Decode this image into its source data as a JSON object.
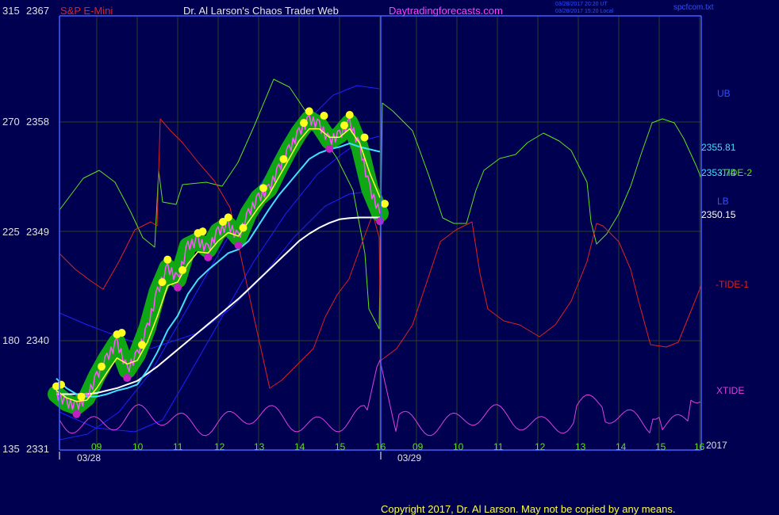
{
  "header": {
    "instrument": "S&P E-Mini",
    "title": "Dr. Al Larson's Chaos Trader Web",
    "site": "Daytradingforecasts.com",
    "stamp_line1": "03/28/2017 20:20 UT",
    "stamp_line2": "03/28/2017 15:20 Local",
    "file": "spcfcom.txt"
  },
  "footer": {
    "copyright": "Copyright 2017, Dr. Al Larson. May not be copied by any means."
  },
  "colors": {
    "background": "#000050",
    "grid": "#2e3f20",
    "frame": "#4060ff",
    "price": "#ff55ff",
    "fast_avg": "#ffff40",
    "mid_avg": "#40e0ff",
    "slow_avg": "#ffffff",
    "bands": "#2020ff",
    "tide1": "#e02020",
    "tide2": "#60e020",
    "xtide": "#e040e0",
    "highlight": "#10b010",
    "peak_dot": "#ffff20",
    "trough_dot": "#c020c0"
  },
  "chart_data": {
    "type": "line",
    "title": "S&P E-Mini",
    "x_time_labels": [
      "09",
      "10",
      "11",
      "12",
      "13",
      "14",
      "15",
      "16",
      "09",
      "10",
      "11",
      "12",
      "13",
      "14",
      "15",
      "16"
    ],
    "date_labels": [
      "03/28",
      "03/29"
    ],
    "year_label": "2017",
    "y_left_outer": [
      "315",
      "270",
      "225",
      "180",
      "135"
    ],
    "y_left_price": [
      "2367",
      "2358",
      "2349",
      "2340",
      "2331"
    ],
    "ylim": [
      2331,
      2367
    ],
    "right_labels": {
      "ub": "UB",
      "cyan_value": "2355.81",
      "upper_value": "2353.74",
      "tide2": "-TIDE-2",
      "lb": "LB",
      "white_value": "2350.15",
      "tide1": "-TIDE-1",
      "xtide": "XTIDE"
    },
    "x": [
      8.0,
      8.25,
      8.5,
      8.75,
      9.0,
      9.25,
      9.5,
      9.75,
      10.0,
      10.25,
      10.5,
      10.75,
      11.0,
      11.25,
      11.5,
      11.75,
      12.0,
      12.25,
      12.5,
      12.75,
      13.0,
      13.25,
      13.5,
      13.75,
      14.0,
      14.25,
      14.5,
      14.75,
      15.0,
      15.25,
      15.5,
      15.75,
      16.0
    ],
    "series": [
      {
        "name": "price",
        "values": [
          2335.5,
          2334.8,
          2334.5,
          2335.2,
          2337.0,
          2338.5,
          2339.8,
          2337.5,
          2338.8,
          2341.0,
          2344.0,
          2346.0,
          2345.0,
          2347.8,
          2348.2,
          2347.5,
          2349.0,
          2349.5,
          2348.5,
          2350.5,
          2351.8,
          2352.5,
          2354.2,
          2355.8,
          2357.2,
          2358.3,
          2357.8,
          2356.5,
          2357.0,
          2358.0,
          2356.0,
          2352.5,
          2350.5
        ]
      },
      {
        "name": "fast average",
        "values": [
          2335.8,
          2335.2,
          2334.9,
          2335.0,
          2336.0,
          2337.3,
          2338.5,
          2338.0,
          2338.3,
          2339.8,
          2342.0,
          2344.5,
          2344.8,
          2346.3,
          2347.3,
          2347.2,
          2348.2,
          2348.9,
          2348.6,
          2349.8,
          2351.0,
          2352.0,
          2353.5,
          2355.0,
          2356.5,
          2357.5,
          2357.5,
          2356.8,
          2356.8,
          2357.5,
          2356.3,
          2353.8,
          2351.8
        ]
      },
      {
        "name": "mid average",
        "values": [
          2336.8,
          2336.0,
          2335.5,
          2335.3,
          2335.3,
          2335.5,
          2335.8,
          2336.0,
          2336.3,
          2337.5,
          2339.0,
          2340.8,
          2342.0,
          2343.8,
          2345.0,
          2345.8,
          2346.5,
          2347.2,
          2347.5,
          2348.2,
          2349.5,
          2350.8,
          2352.0,
          2353.0,
          2354.0,
          2355.0,
          2355.5,
          2355.8,
          2356.0,
          2356.3,
          2356.0,
          2355.8,
          2355.6
        ]
      },
      {
        "name": "slow average",
        "values": [
          2335.5,
          2335.5,
          2335.5,
          2335.5,
          2335.6,
          2335.8,
          2336.0,
          2336.3,
          2336.6,
          2337.2,
          2337.8,
          2338.5,
          2339.2,
          2339.9,
          2340.6,
          2341.3,
          2342.0,
          2342.7,
          2343.4,
          2344.2,
          2345.0,
          2345.8,
          2346.6,
          2347.4,
          2348.2,
          2348.8,
          2349.3,
          2349.7,
          2350.0,
          2350.1,
          2350.15,
          2350.15,
          2350.15
        ]
      }
    ]
  }
}
